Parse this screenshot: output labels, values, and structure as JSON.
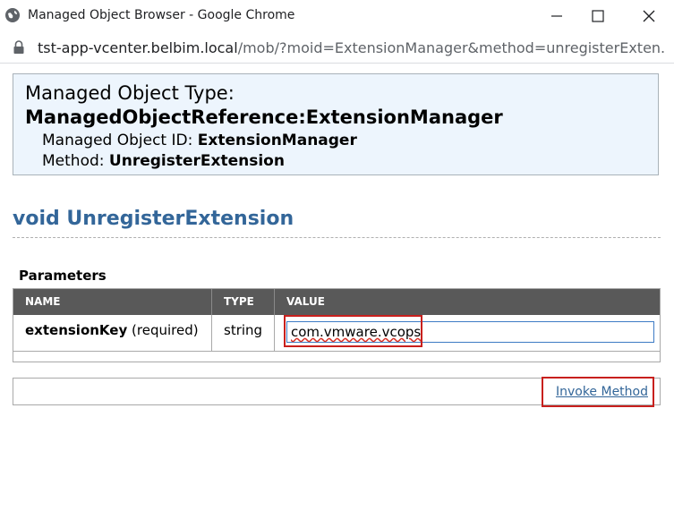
{
  "window": {
    "title": "Managed Object Browser - Google Chrome",
    "icon": "globe-icon"
  },
  "address_bar": {
    "host": "tst-app-vcenter.belbim.local",
    "path": "/mob/?moid=ExtensionManager&method=unregisterExten..."
  },
  "header": {
    "type_label": "Managed Object Type:",
    "type_value": "ManagedObjectReference:ExtensionManager",
    "moid_label": "Managed Object ID:",
    "moid_value": "ExtensionManager",
    "method_label": "Method:",
    "method_value": "UnregisterExtension"
  },
  "method_title": "void UnregisterExtension",
  "parameters": {
    "label": "Parameters",
    "columns": [
      "NAME",
      "TYPE",
      "VALUE"
    ],
    "rows": [
      {
        "name": "extensionKey",
        "required": "(required)",
        "type": "string",
        "value": "com.vmware.vcops"
      }
    ]
  },
  "invoke_label": "Invoke Method",
  "colors": {
    "accent": "#336699",
    "header_bg": "#edf5fd",
    "table_header_bg": "#595959",
    "highlight": "#c8201d"
  }
}
